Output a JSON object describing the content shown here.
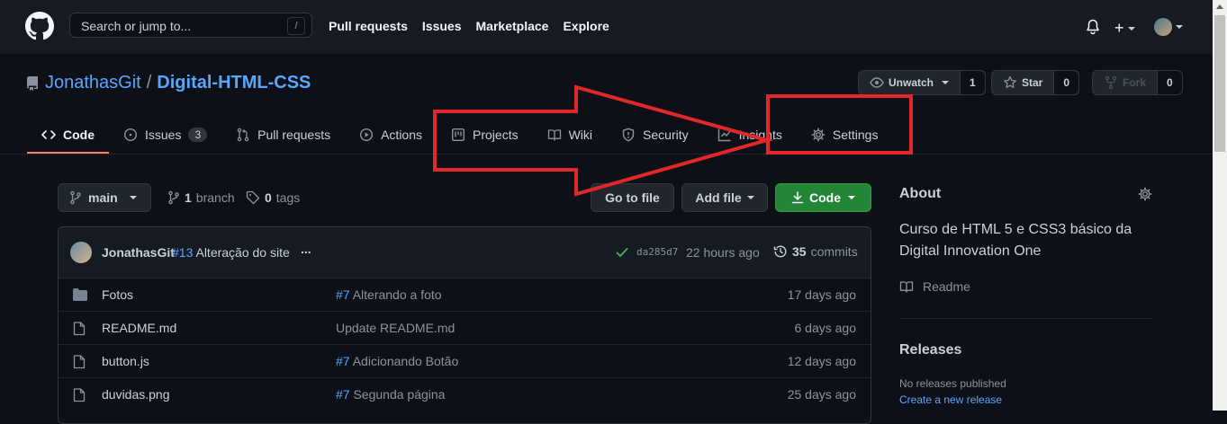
{
  "header": {
    "search_placeholder": "Search or jump to...",
    "search_shortcut": "/",
    "nav": [
      "Pull requests",
      "Issues",
      "Marketplace",
      "Explore"
    ],
    "plus_label": "+"
  },
  "repo": {
    "owner": "JonathasGit",
    "separator": "/",
    "name": "Digital-HTML-CSS",
    "watch_label": "Unwatch",
    "watch_count": "1",
    "star_label": "Star",
    "star_count": "0",
    "fork_label": "Fork",
    "fork_count": "0"
  },
  "tabs": [
    {
      "label": "Code",
      "icon": "code-icon"
    },
    {
      "label": "Issues",
      "icon": "issue-icon",
      "count": "3"
    },
    {
      "label": "Pull requests",
      "icon": "pull-request-icon"
    },
    {
      "label": "Actions",
      "icon": "play-icon"
    },
    {
      "label": "Projects",
      "icon": "project-icon"
    },
    {
      "label": "Wiki",
      "icon": "book-icon"
    },
    {
      "label": "Security",
      "icon": "shield-icon"
    },
    {
      "label": "Insights",
      "icon": "graph-icon"
    },
    {
      "label": "Settings",
      "icon": "gear-icon"
    }
  ],
  "branch": {
    "current": "main",
    "branch_count": "1",
    "branch_word": "branch",
    "tag_count": "0",
    "tag_word": "tags",
    "goto_file": "Go to file",
    "add_file": "Add file",
    "code": "Code"
  },
  "commit": {
    "author": "JonathasGit",
    "pr": "#13",
    "message": "Alteração do site",
    "ellipsis": "...",
    "sha": "da285d7",
    "ago": "22 hours ago",
    "count": "35",
    "count_word": "commits"
  },
  "files": [
    {
      "type": "folder",
      "name": "Fotos",
      "pr": "#7",
      "message": "Alterando a foto",
      "age": "17 days ago"
    },
    {
      "type": "file",
      "name": "README.md",
      "pr": "",
      "message": "Update README.md",
      "age": "6 days ago"
    },
    {
      "type": "file",
      "name": "button.js",
      "pr": "#7",
      "message": "Adicionando Botão",
      "age": "12 days ago"
    },
    {
      "type": "file",
      "name": "duvidas.png",
      "pr": "#7",
      "message": "Segunda página",
      "age": "25 days ago"
    }
  ],
  "about": {
    "heading": "About",
    "description": "Curso de HTML 5 e CSS3 básico da Digital Innovation One",
    "readme": "Readme"
  },
  "releases": {
    "heading": "Releases",
    "none": "No releases published",
    "create_link": "Create a new release"
  },
  "annotation_color": "#e3262a",
  "colors": {
    "link": "#58a6ff",
    "green_button": "#238636",
    "tab_underline": "#f78166"
  }
}
